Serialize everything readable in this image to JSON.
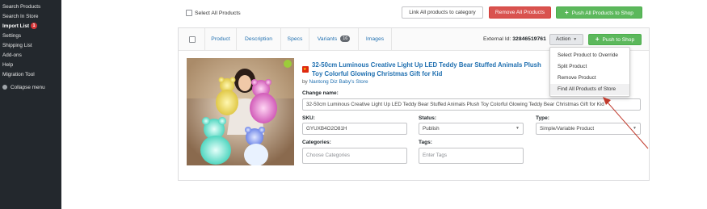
{
  "sidebar": {
    "items": [
      {
        "label": "Search Products"
      },
      {
        "label": "Search In Store"
      },
      {
        "label": "Import List",
        "badge": "1"
      },
      {
        "label": "Settings"
      },
      {
        "label": "Shipping List"
      },
      {
        "label": "Add-ons"
      },
      {
        "label": "Help"
      },
      {
        "label": "Migration Tool"
      }
    ],
    "collapse_label": "Collapse menu"
  },
  "toolbar": {
    "select_all_label": "Select All Products",
    "link_all_label": "Link All products to category",
    "remove_all_label": "Remove All Products",
    "push_all_label": "Push All Products to Shop"
  },
  "card": {
    "tabs": [
      {
        "label": "Product"
      },
      {
        "label": "Description"
      },
      {
        "label": "Specs"
      },
      {
        "label": "Variants",
        "count": "16"
      },
      {
        "label": "Images"
      }
    ],
    "external_id_label": "External Id:",
    "external_id_value": "32846519761",
    "action_label": "Action",
    "push_label": "Push to Shop",
    "action_menu": [
      {
        "label": "Select Product to Override"
      },
      {
        "label": "Split Product"
      },
      {
        "label": "Remove Product"
      },
      {
        "label": "Find All Products of Store"
      }
    ],
    "title": "32-50cm Luminous Creative Light Up LED Teddy Bear Stuffed Animals Plush Toy Colorful Glowing Christmas Gift for Kid",
    "by_label": "by",
    "store_name": "Nantong Diz Baby's Store",
    "change_name_label": "Change name:",
    "change_name_value": "32-50cm Luminous Creative Light Up LED Teddy Bear Stuffed Animals Plush Toy Colorful Glowing Teddy Bear Christmas Gift for Kid",
    "sku_label": "SKU:",
    "sku_value": "GYUXB4O2O81H",
    "status_label": "Status:",
    "status_value": "Publish",
    "type_label": "Type:",
    "type_value": "Simple/Variable Product",
    "categories_label": "Categories:",
    "categories_placeholder": "Choose Categories",
    "tags_label": "Tags:",
    "tags_placeholder": "Enter Tags"
  },
  "colors": {
    "sidebar_bg": "#23282d",
    "link_blue": "#2271b1",
    "danger_red": "#d9534f",
    "success_green": "#5cb85c",
    "annotation_arrow": "#c0392b"
  },
  "icons": [
    "checkbox-icon",
    "plus-icon",
    "caret-down-icon",
    "china-flag-icon",
    "collapse-menu-icon"
  ]
}
